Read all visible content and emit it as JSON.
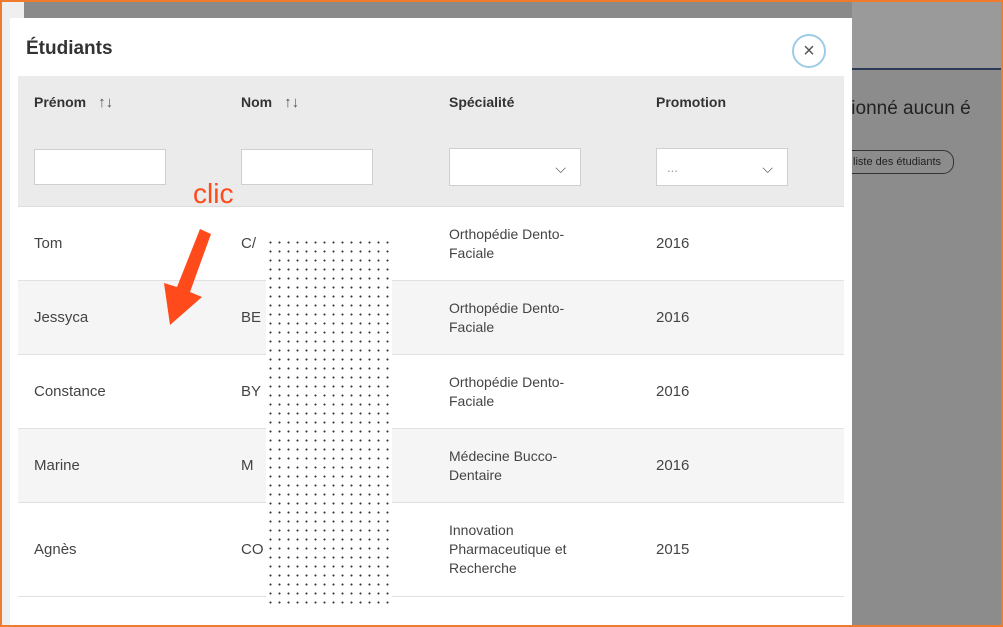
{
  "background": {
    "partial_text": "tionné aucun é",
    "button_label": "liste des étudiants"
  },
  "modal": {
    "title": "Étudiants",
    "close_icon": "×",
    "columns": [
      {
        "label": "Prénom",
        "sortable": true
      },
      {
        "label": "Nom",
        "sortable": true
      },
      {
        "label": "Spécialité",
        "sortable": false
      },
      {
        "label": "Promotion",
        "sortable": false
      }
    ],
    "sort_icon": "↑↓",
    "filters": {
      "prenom_value": "",
      "nom_value": "",
      "specialite_value": "",
      "promotion_placeholder": "..."
    },
    "rows": [
      {
        "prenom": "Tom",
        "nom": "C/",
        "specialite_l1": "Orthopédie Dento-",
        "specialite_l2": "Faciale",
        "specialite_l3": "",
        "promotion": "2016"
      },
      {
        "prenom": "Jessyca",
        "nom": "BE",
        "specialite_l1": "Orthopédie Dento-",
        "specialite_l2": "Faciale",
        "specialite_l3": "",
        "promotion": "2016"
      },
      {
        "prenom": "Constance",
        "nom": "BY",
        "specialite_l1": "Orthopédie Dento-",
        "specialite_l2": "Faciale",
        "specialite_l3": "",
        "promotion": "2016"
      },
      {
        "prenom": "Marine",
        "nom": "M",
        "specialite_l1": "Médecine Bucco-",
        "specialite_l2": "Dentaire",
        "specialite_l3": "",
        "promotion": "2016"
      },
      {
        "prenom": "Agnès",
        "nom": "CO",
        "specialite_l1": "Innovation",
        "specialite_l2": "Pharmaceutique et",
        "specialite_l3": "Recherche",
        "promotion": "2015"
      }
    ]
  },
  "annotation": {
    "label": "clic",
    "color": "#ff4a1c"
  },
  "colors": {
    "frame_border": "#f07a2e",
    "header_bg": "#ebebeb",
    "close_ring": "#9ecbe6"
  }
}
